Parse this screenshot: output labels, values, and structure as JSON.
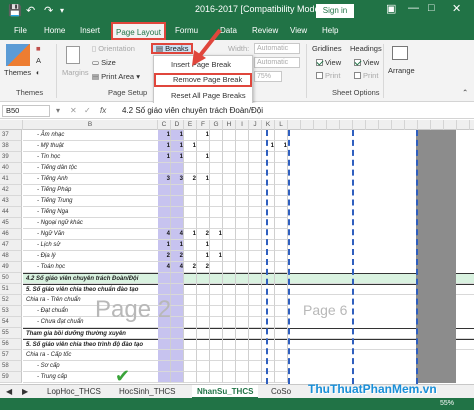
{
  "titlebar": {
    "title": "2016-2017 [Compatibility Mode] - Excel",
    "signin": "Sign in",
    "save_icon": "save-icon",
    "undo_icon": "undo-icon",
    "redo_icon": "redo-icon"
  },
  "tabs": [
    "File",
    "Home",
    "Insert",
    "Page Layout",
    "Formu",
    "Data",
    "Review",
    "View",
    "Help"
  ],
  "ribbon": {
    "themes": "Themes",
    "themes_group": "Themes",
    "margins": "Margins",
    "orientation": "Orientation",
    "size": "Size",
    "print_area": "Print Area",
    "breaks": "Breaks",
    "width_label": "Width:",
    "width_value": "Automatic",
    "height_value": "Automatic",
    "scale_value": "75%",
    "page_setup_group": "Page Setup",
    "gridlines": "Gridlines",
    "headings": "Headings",
    "view": "View",
    "print": "Print",
    "sheet_options_group": "Sheet Options",
    "arrange": "Arrange"
  },
  "breaks_menu": {
    "insert": "Insert Page Break",
    "remove": "Remove Page Break",
    "reset": "Reset All Page Breaks"
  },
  "formula_bar": {
    "name_box": "B50",
    "fx": "fx",
    "content": "4.2 Số giáo viên chuyên trách Đoàn/Đội"
  },
  "columns": [
    "B",
    "C",
    "D",
    "E",
    "F",
    "G",
    "H",
    "I",
    "J",
    "K",
    "L"
  ],
  "rows": [
    {
      "n": "37",
      "label": "- Âm nhạc",
      "vals": [
        "1",
        "1",
        "",
        "1",
        "",
        "",
        "",
        "",
        "",
        ""
      ]
    },
    {
      "n": "38",
      "label": "- Mỹ thuật",
      "vals": [
        "1",
        "1",
        "1",
        "",
        "",
        "",
        "",
        "",
        "1",
        "1"
      ]
    },
    {
      "n": "39",
      "label": "- Tin học",
      "vals": [
        "1",
        "1",
        "",
        "1",
        "",
        "",
        "",
        "",
        "",
        ""
      ]
    },
    {
      "n": "40",
      "label": "- Tiếng dân tộc",
      "vals": [
        "",
        "",
        "",
        "",
        "",
        "",
        "",
        "",
        "",
        ""
      ]
    },
    {
      "n": "41",
      "label": "- Tiếng Anh",
      "vals": [
        "3",
        "3",
        "2",
        "1",
        "",
        "",
        "",
        "",
        "",
        ""
      ]
    },
    {
      "n": "42",
      "label": "- Tiếng Pháp",
      "vals": [
        "",
        "",
        "",
        "",
        "",
        "",
        "",
        "",
        "",
        ""
      ]
    },
    {
      "n": "43",
      "label": "- Tiếng Trung",
      "vals": [
        "",
        "",
        "",
        "",
        "",
        "",
        "",
        "",
        "",
        ""
      ]
    },
    {
      "n": "44",
      "label": "- Tiếng Nga",
      "vals": [
        "",
        "",
        "",
        "",
        "",
        "",
        "",
        "",
        "",
        ""
      ]
    },
    {
      "n": "45",
      "label": "- Ngoại ngữ khác",
      "vals": [
        "",
        "",
        "",
        "",
        "",
        "",
        "",
        "",
        "",
        ""
      ]
    },
    {
      "n": "46",
      "label": "- Ngữ Văn",
      "vals": [
        "4",
        "4",
        "1",
        "2",
        "1",
        "",
        "",
        "",
        "",
        ""
      ]
    },
    {
      "n": "47",
      "label": "- Lịch sử",
      "vals": [
        "1",
        "1",
        "",
        "1",
        "",
        "",
        "",
        "",
        "",
        ""
      ]
    },
    {
      "n": "48",
      "label": "- Địa lý",
      "vals": [
        "2",
        "2",
        "",
        "1",
        "1",
        "",
        "",
        "",
        "",
        ""
      ]
    },
    {
      "n": "49",
      "label": "- Toán học",
      "vals": [
        "4",
        "4",
        "2",
        "2",
        "",
        "",
        "",
        "",
        "",
        ""
      ]
    },
    {
      "n": "50",
      "label": "4.2 Số giáo viên chuyên trách Đoàn/Đội",
      "vals": [
        "",
        "",
        "",
        "",
        "",
        "",
        "",
        "",
        "",
        ""
      ]
    },
    {
      "n": "51",
      "label": "5. Số giáo viên chia theo chuẩn đào tạo",
      "vals": [
        "",
        "",
        "",
        "",
        "",
        "",
        "",
        "",
        "",
        ""
      ]
    },
    {
      "n": "52",
      "label": "Chia ra - Trên chuẩn",
      "vals": [
        "",
        "",
        "",
        "",
        "",
        "",
        "",
        "",
        "",
        ""
      ]
    },
    {
      "n": "53",
      "label": "- Đạt chuẩn",
      "vals": [
        "",
        "",
        "",
        "",
        "",
        "",
        "",
        "",
        "",
        ""
      ]
    },
    {
      "n": "54",
      "label": "- Chưa đạt chuẩn",
      "vals": [
        "",
        "",
        "",
        "",
        "",
        "",
        "",
        "",
        "",
        ""
      ]
    },
    {
      "n": "55",
      "label": "Tham gia bồi dưỡng thường xuyên",
      "vals": [
        "",
        "",
        "",
        "",
        "",
        "",
        "",
        "",
        "",
        ""
      ]
    },
    {
      "n": "56",
      "label": "5. Số giáo viên chia theo trình độ đào tạo",
      "vals": [
        "",
        "",
        "",
        "",
        "",
        "",
        "",
        "",
        "",
        ""
      ]
    },
    {
      "n": "57",
      "label": "Chia ra - Cấp tốc",
      "vals": [
        "",
        "",
        "",
        "",
        "",
        "",
        "",
        "",
        "",
        ""
      ]
    },
    {
      "n": "58",
      "label": "- Sơ cấp",
      "vals": [
        "",
        "",
        "",
        "",
        "",
        "",
        "",
        "",
        "",
        ""
      ]
    },
    {
      "n": "59",
      "label": "- Trung cấp",
      "vals": [
        "",
        "",
        "",
        "",
        "",
        "",
        "",
        "",
        "",
        ""
      ]
    }
  ],
  "page_labels": {
    "p2": "Page 2",
    "p6": "Page 6"
  },
  "sheet_tabs": [
    "LopHoc_THCS",
    "HocSinh_THCS",
    "NhanSu_THCS",
    "CoSo"
  ],
  "status": {
    "zoom": "55%"
  },
  "watermark": "ThuThuatPhanMem.vn",
  "colors": {
    "excel_green": "#217346",
    "highlight_red": "#e0463c",
    "purple_fill": "#c7c3ef"
  }
}
